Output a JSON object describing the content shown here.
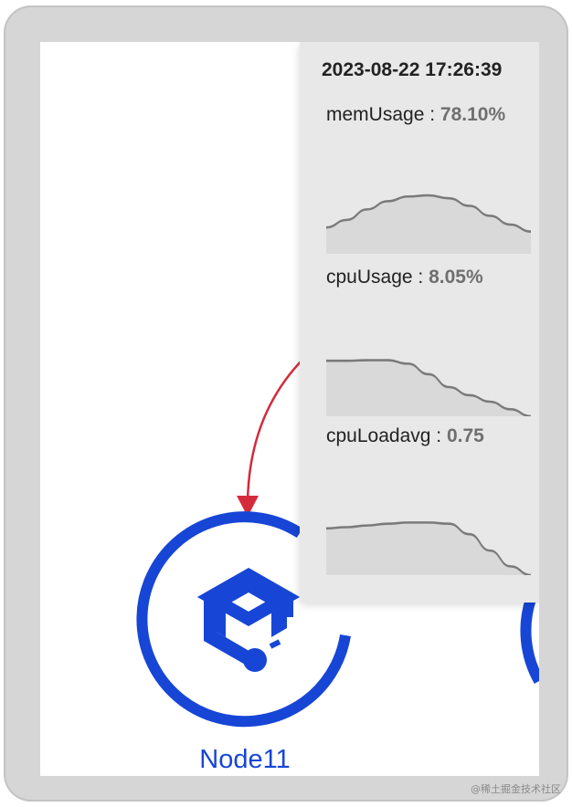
{
  "tooltip": {
    "timestamp": "2023-08-22 17:26:39",
    "metrics": [
      {
        "name": "memUsage",
        "separator": " : ",
        "value": "78.10%",
        "trend": [
          0.45,
          0.58,
          0.76,
          0.9,
          0.98,
          1.0,
          0.95,
          0.82,
          0.65,
          0.5,
          0.38
        ]
      },
      {
        "name": "cpuUsage",
        "separator": " : ",
        "value": "8.05%",
        "trend": [
          0.95,
          0.95,
          0.96,
          0.96,
          0.9,
          0.72,
          0.5,
          0.36,
          0.25,
          0.12,
          0.0
        ]
      },
      {
        "name": "cpuLoadavg",
        "separator": " : ",
        "value": "0.75",
        "trend": [
          0.8,
          0.82,
          0.85,
          0.88,
          0.9,
          0.9,
          0.88,
          0.7,
          0.42,
          0.15,
          0.0
        ]
      }
    ]
  },
  "node": {
    "label": "Node11",
    "icon": "cube-node-icon"
  },
  "colors": {
    "node": "#1746d6",
    "edge": "#d42a3c",
    "spark_line": "#7a7a7a",
    "spark_fill": "#d9d9d9"
  },
  "watermark": "@稀土掘金技术社区"
}
